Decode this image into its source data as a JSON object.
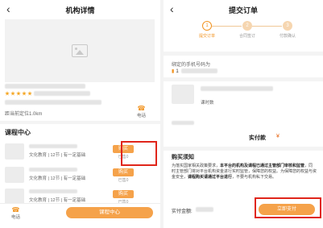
{
  "left": {
    "title": "机构详情",
    "back_glyph": "‹",
    "distance": "距当前定位1.0km",
    "phone_label": "电话",
    "section_title": "课程中心",
    "courses": [
      {
        "desc": "文化教育 | 12节 | 有一定基础",
        "buy_label": "购买",
        "sold": "已售0"
      },
      {
        "desc": "文化教育 | 12节 | 有一定基础",
        "buy_label": "购买",
        "sold": "已售0"
      },
      {
        "desc": "文化教育 | 12节 | 有一定基础",
        "buy_label": "购买",
        "sold": "已售0"
      }
    ],
    "bottom": {
      "tel_label": "电话",
      "center_button": "课程中心"
    }
  },
  "right": {
    "title": "提交订单",
    "back_glyph": "‹",
    "steps": [
      {
        "num": "1",
        "label": "提交订单"
      },
      {
        "num": "2",
        "label": "合同签订"
      },
      {
        "num": "3",
        "label": "付款确认"
      }
    ],
    "bind_label": "绑定的手机号码为",
    "bind_phone": "1",
    "course_desc": "课时数",
    "pay_label": "实付款",
    "pay_value": "¥",
    "notice": {
      "title": "购买须知",
      "body_a": "为落实国家相关政策要求，",
      "body_b": "本平台的机构及课程已通过主管部门审核和监管",
      "body_c": "，同时主管部门将对平台机构资金进行实时监管，保障您的权益。为保障您的权益与资金安全，",
      "body_d": "课程购买请通过平台进行",
      "body_e": "，不要与机构私下交易。"
    },
    "amount_label": "实付金额:",
    "submit_label": "立即支付"
  },
  "colors": {
    "accent": "#f5a24a",
    "highlight": "#e0261b",
    "price": "#e76a1a"
  }
}
